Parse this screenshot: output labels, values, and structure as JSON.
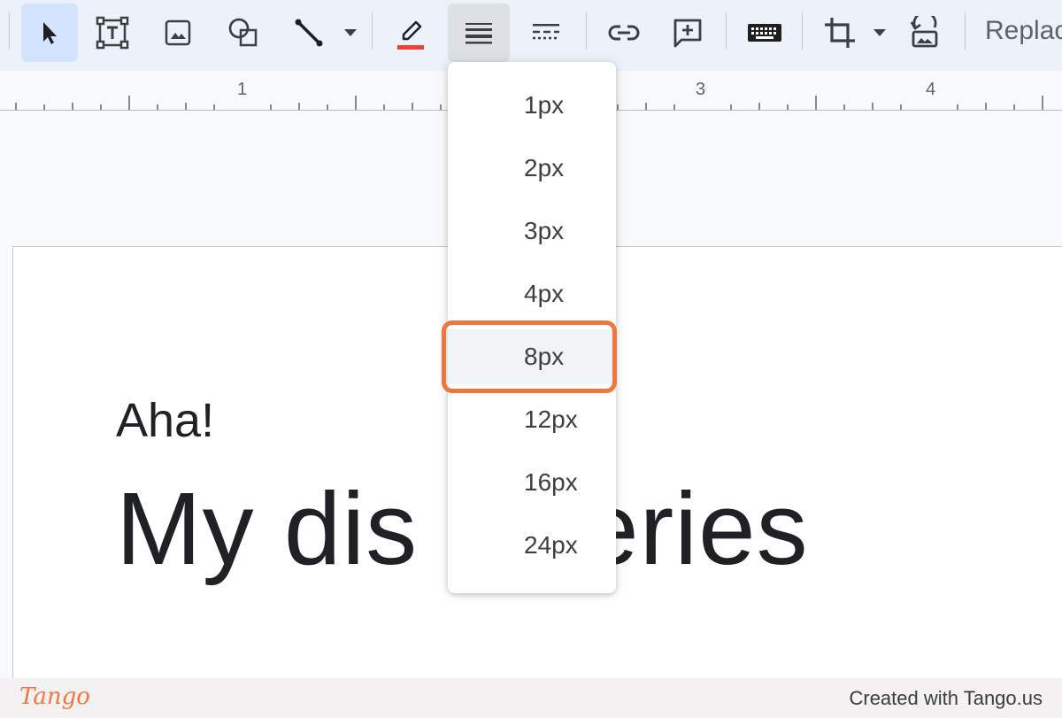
{
  "toolbar": {
    "replace_label": "Replac",
    "line_color": "#ea4335",
    "active_tool": "select"
  },
  "ruler": {
    "labels": [
      "1",
      "3",
      "4"
    ]
  },
  "slide": {
    "subtitle": "Aha!",
    "title_left": "My dis",
    "title_right": "eries"
  },
  "weight_menu": {
    "options": [
      "1px",
      "2px",
      "3px",
      "4px",
      "8px",
      "12px",
      "16px",
      "24px"
    ],
    "highlighted": "8px"
  },
  "footer": {
    "logo": "Tango",
    "credit": "Created with Tango.us"
  },
  "colors": {
    "accent": "#f0773b",
    "active_button": "#d3e3fd"
  }
}
